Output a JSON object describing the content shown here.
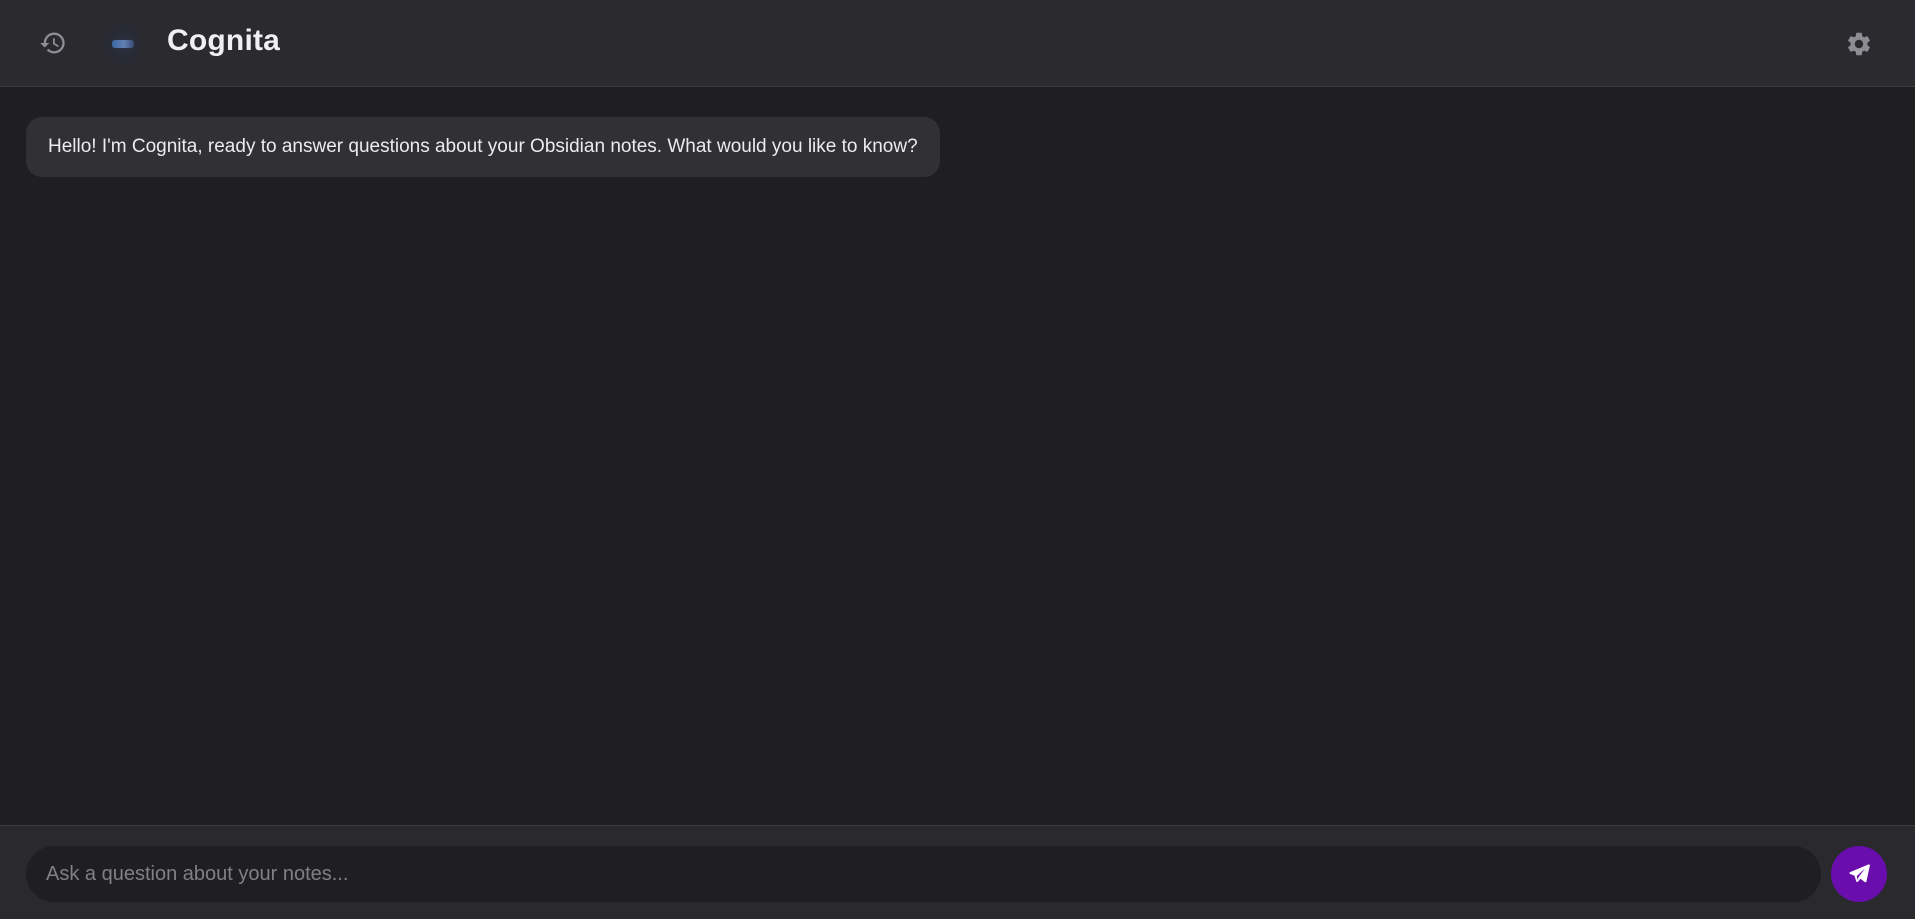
{
  "header": {
    "title": "Cognita",
    "history_icon": "history-icon",
    "settings_icon": "gear-icon",
    "logo": "app-logo"
  },
  "messages": [
    {
      "role": "assistant",
      "text": "Hello! I'm Cognita, ready to answer questions about your Obsidian notes. What would you like to know?"
    }
  ],
  "composer": {
    "placeholder": "Ask a question about your notes...",
    "value": "",
    "send_icon": "paper-plane-icon"
  },
  "colors": {
    "background": "#1f1f22",
    "header": "#2a2a2f",
    "bubble": "#303035",
    "accent": "#6a0dad"
  }
}
